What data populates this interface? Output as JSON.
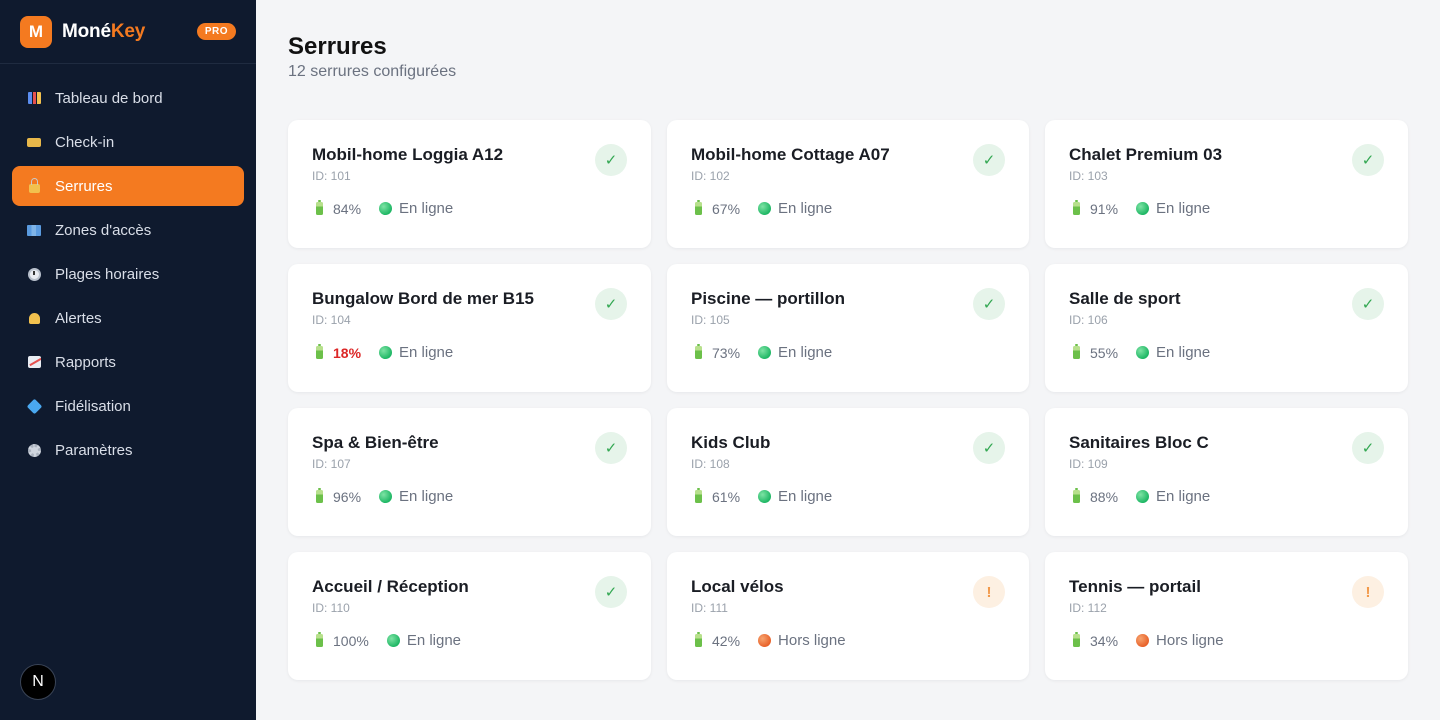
{
  "brand": {
    "logo_letter": "M",
    "name_part1": "Moné",
    "name_part2": "Key",
    "badge": "PRO",
    "accent_color": "#f47a20"
  },
  "sidebar": {
    "items": [
      {
        "label": "Tableau de bord",
        "icon": "bar-chart-icon",
        "active": false
      },
      {
        "label": "Check-in",
        "icon": "ticket-icon",
        "active": false
      },
      {
        "label": "Serrures",
        "icon": "lock-icon",
        "active": true
      },
      {
        "label": "Zones d'accès",
        "icon": "map-icon",
        "active": false
      },
      {
        "label": "Plages horaires",
        "icon": "clock-icon",
        "active": false
      },
      {
        "label": "Alertes",
        "icon": "bell-icon",
        "active": false
      },
      {
        "label": "Rapports",
        "icon": "trend-chart-icon",
        "active": false
      },
      {
        "label": "Fidélisation",
        "icon": "gem-icon",
        "active": false
      },
      {
        "label": "Paramètres",
        "icon": "gear-icon",
        "active": false
      }
    ],
    "avatar_letter": "N"
  },
  "page": {
    "title": "Serrures",
    "subtitle": "12 serrures configurées"
  },
  "locks": [
    {
      "name": "Mobil-home Loggia A12",
      "id": "ID: 101",
      "battery": "84%",
      "battery_low": false,
      "status": "En ligne",
      "online": true,
      "state_icon": "✓"
    },
    {
      "name": "Mobil-home Cottage A07",
      "id": "ID: 102",
      "battery": "67%",
      "battery_low": false,
      "status": "En ligne",
      "online": true,
      "state_icon": "✓"
    },
    {
      "name": "Chalet Premium 03",
      "id": "ID: 103",
      "battery": "91%",
      "battery_low": false,
      "status": "En ligne",
      "online": true,
      "state_icon": "✓"
    },
    {
      "name": "Bungalow Bord de mer B15",
      "id": "ID: 104",
      "battery": "18%",
      "battery_low": true,
      "status": "En ligne",
      "online": true,
      "state_icon": "✓"
    },
    {
      "name": "Piscine — portillon",
      "id": "ID: 105",
      "battery": "73%",
      "battery_low": false,
      "status": "En ligne",
      "online": true,
      "state_icon": "✓"
    },
    {
      "name": "Salle de sport",
      "id": "ID: 106",
      "battery": "55%",
      "battery_low": false,
      "status": "En ligne",
      "online": true,
      "state_icon": "✓"
    },
    {
      "name": "Spa & Bien-être",
      "id": "ID: 107",
      "battery": "96%",
      "battery_low": false,
      "status": "En ligne",
      "online": true,
      "state_icon": "✓"
    },
    {
      "name": "Kids Club",
      "id": "ID: 108",
      "battery": "61%",
      "battery_low": false,
      "status": "En ligne",
      "online": true,
      "state_icon": "✓"
    },
    {
      "name": "Sanitaires Bloc C",
      "id": "ID: 109",
      "battery": "88%",
      "battery_low": false,
      "status": "En ligne",
      "online": true,
      "state_icon": "✓"
    },
    {
      "name": "Accueil / Réception",
      "id": "ID: 110",
      "battery": "100%",
      "battery_low": false,
      "status": "En ligne",
      "online": true,
      "state_icon": "✓"
    },
    {
      "name": "Local vélos",
      "id": "ID: 111",
      "battery": "42%",
      "battery_low": false,
      "status": "Hors ligne",
      "online": false,
      "state_icon": "!"
    },
    {
      "name": "Tennis — portail",
      "id": "ID: 112",
      "battery": "34%",
      "battery_low": false,
      "status": "Hors ligne",
      "online": false,
      "state_icon": "!"
    }
  ],
  "colors": {
    "sidebar_bg": "#0f1a2e",
    "online": "#1fb765",
    "offline": "#e8622a",
    "low_battery": "#dc2626"
  }
}
